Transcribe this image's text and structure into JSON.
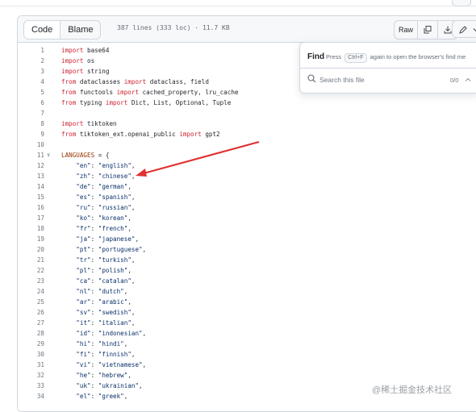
{
  "header": {
    "code_tab": "Code",
    "blame_tab": "Blame",
    "file_meta": "387 lines (333 loc) · 11.7 KB",
    "raw_label": "Raw"
  },
  "find_panel": {
    "title": "Find",
    "hint_prefix": "Press",
    "shortcut": "Ctrl+F",
    "hint_suffix": "again to open the browser's find me",
    "search_placeholder": "Search this file",
    "count": "0/0"
  },
  "code_lines": [
    {
      "n": "1",
      "t": "import base64"
    },
    {
      "n": "2",
      "t": "import os"
    },
    {
      "n": "3",
      "t": "import string"
    },
    {
      "n": "4",
      "t": "from dataclasses import dataclass, field"
    },
    {
      "n": "5",
      "t": "from functools import cached_property, lru_cache"
    },
    {
      "n": "6",
      "t": "from typing import Dict, List, Optional, Tuple"
    },
    {
      "n": "7",
      "t": ""
    },
    {
      "n": "8",
      "t": "import tiktoken"
    },
    {
      "n": "9",
      "t": "from tiktoken_ext.openai_public import gpt2"
    },
    {
      "n": "10",
      "t": ""
    },
    {
      "n": "11",
      "t": "LANGUAGES = {"
    },
    {
      "n": "12",
      "t": "    \"en\": \"english\","
    },
    {
      "n": "13",
      "t": "    \"zh\": \"chinese\","
    },
    {
      "n": "14",
      "t": "    \"de\": \"german\","
    },
    {
      "n": "15",
      "t": "    \"es\": \"spanish\","
    },
    {
      "n": "16",
      "t": "    \"ru\": \"russian\","
    },
    {
      "n": "17",
      "t": "    \"ko\": \"korean\","
    },
    {
      "n": "18",
      "t": "    \"fr\": \"french\","
    },
    {
      "n": "19",
      "t": "    \"ja\": \"japanese\","
    },
    {
      "n": "20",
      "t": "    \"pt\": \"portuguese\","
    },
    {
      "n": "21",
      "t": "    \"tr\": \"turkish\","
    },
    {
      "n": "22",
      "t": "    \"pl\": \"polish\","
    },
    {
      "n": "23",
      "t": "    \"ca\": \"catalan\","
    },
    {
      "n": "24",
      "t": "    \"nl\": \"dutch\","
    },
    {
      "n": "25",
      "t": "    \"ar\": \"arabic\","
    },
    {
      "n": "26",
      "t": "    \"sv\": \"swedish\","
    },
    {
      "n": "27",
      "t": "    \"it\": \"italian\","
    },
    {
      "n": "28",
      "t": "    \"id\": \"indonesian\","
    },
    {
      "n": "29",
      "t": "    \"hi\": \"hindi\","
    },
    {
      "n": "30",
      "t": "    \"fi\": \"finnish\","
    },
    {
      "n": "31",
      "t": "    \"vi\": \"vietnamese\","
    },
    {
      "n": "32",
      "t": "    \"he\": \"hebrew\","
    },
    {
      "n": "33",
      "t": "    \"uk\": \"ukrainian\","
    },
    {
      "n": "34",
      "t": "    \"el\": \"greek\","
    }
  ],
  "icons": {
    "copy": "copy-icon",
    "download": "download-icon",
    "edit": "pencil-icon",
    "more": "chevron-down-icon",
    "search": "search-icon",
    "fold": "chevron-down-icon"
  },
  "colors": {
    "annotation_arrow": "#e03131",
    "keyword": "#cf222e",
    "string": "#0a3069"
  },
  "watermark": "@稀土掘金技术社区"
}
